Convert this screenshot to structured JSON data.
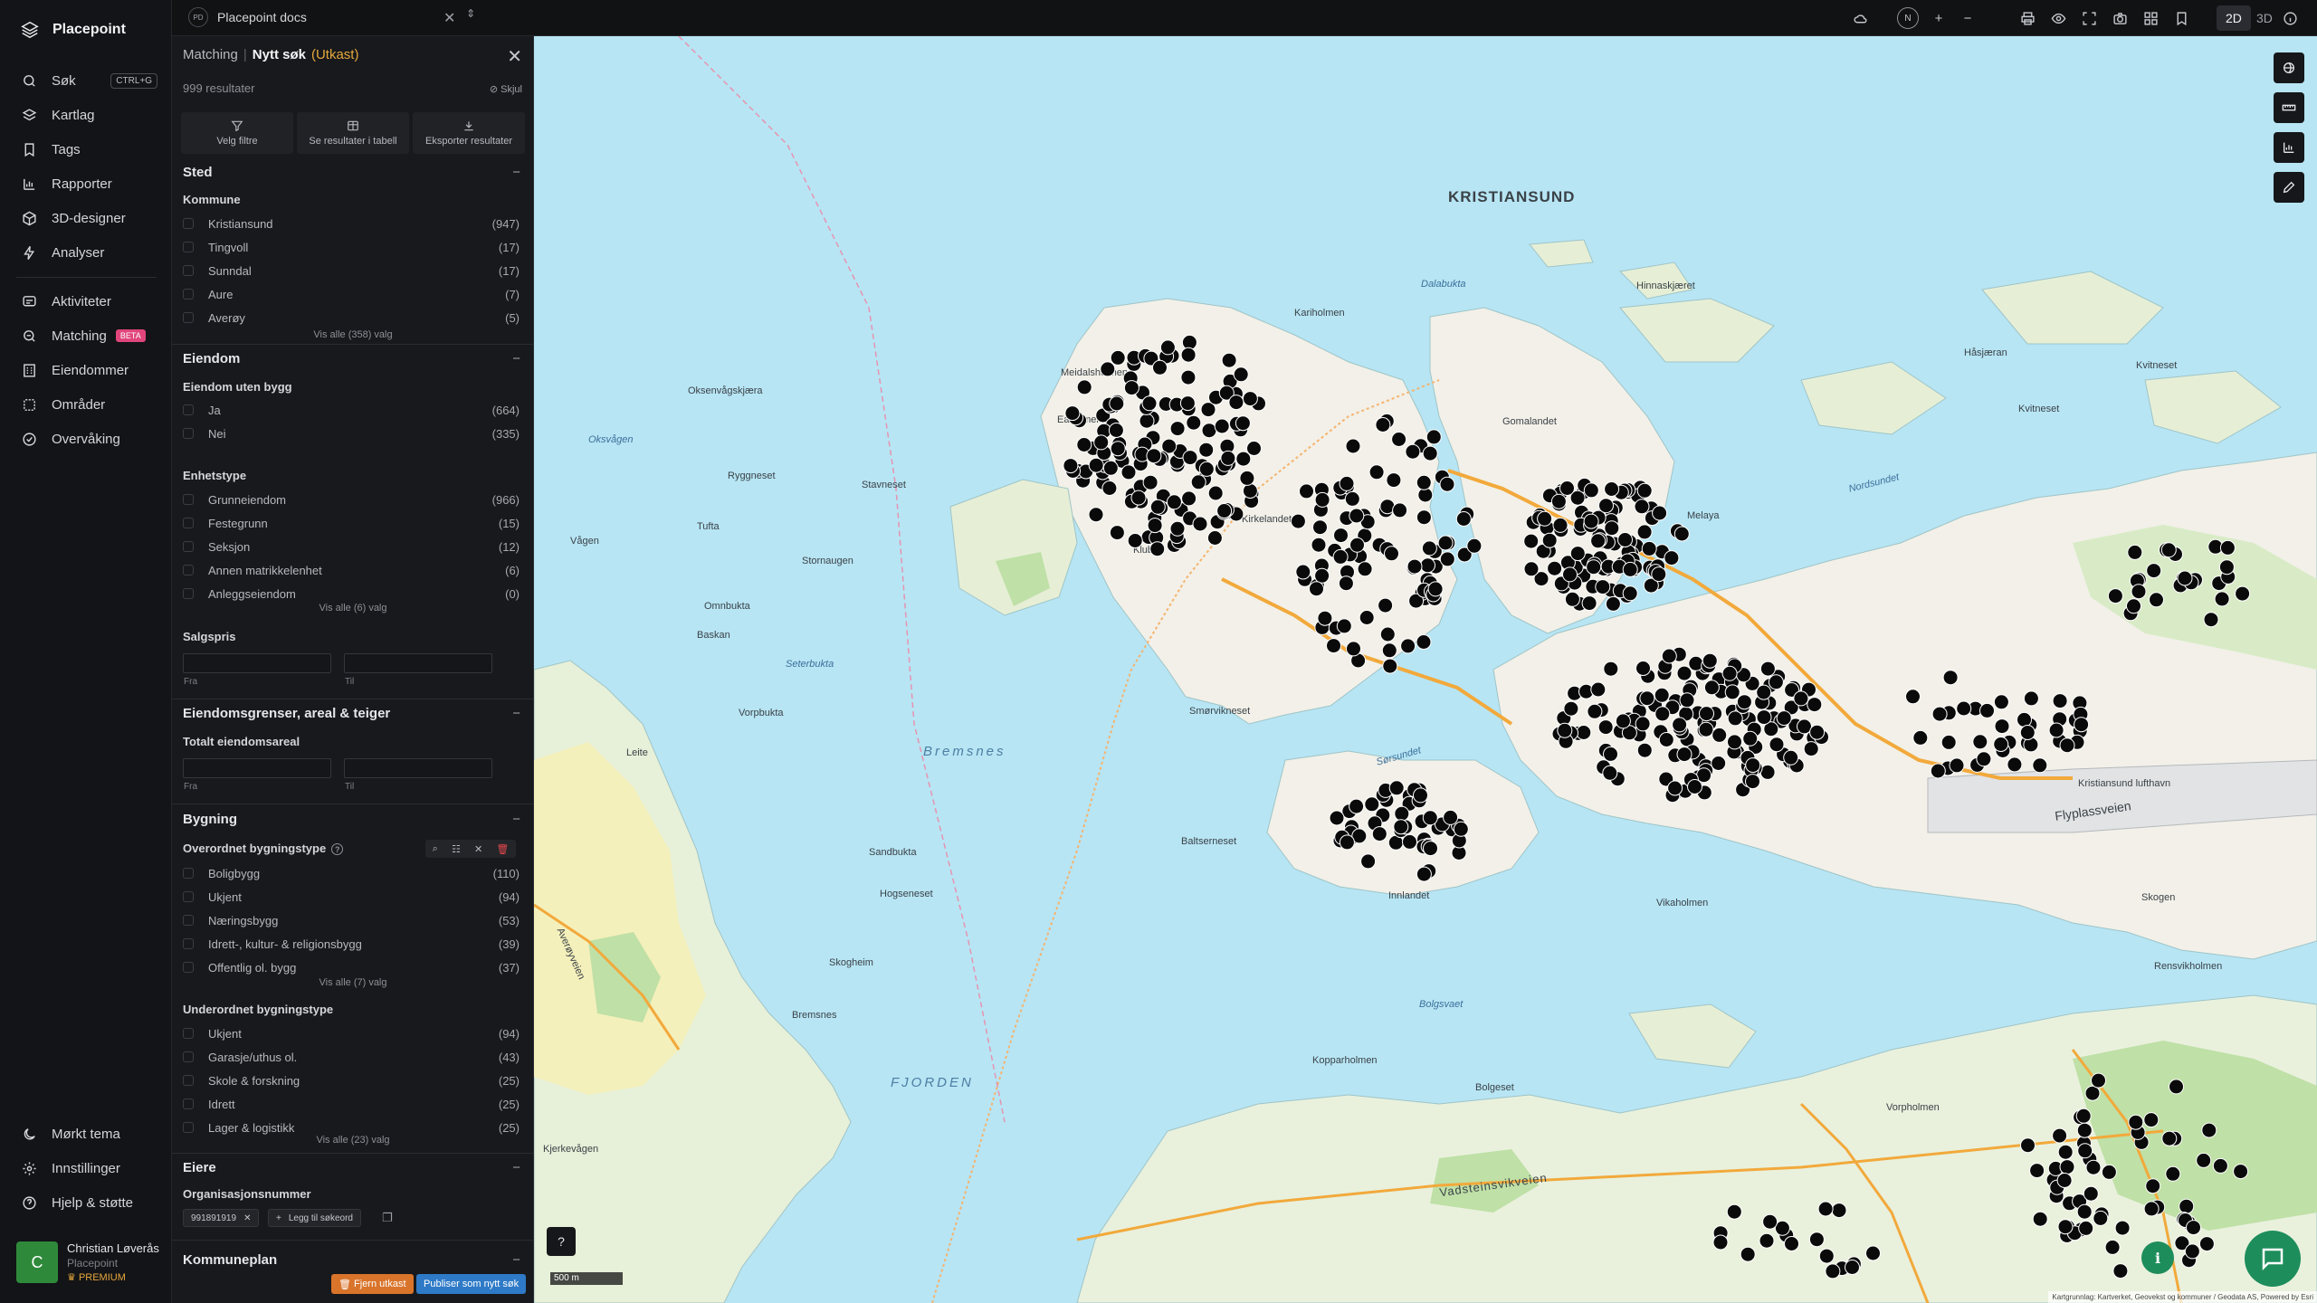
{
  "app": {
    "name": "Placepoint"
  },
  "nav": {
    "items": [
      {
        "label": "Søk",
        "shortcut": "CTRL+G"
      },
      {
        "label": "Kartlag"
      },
      {
        "label": "Tags"
      },
      {
        "label": "Rapporter"
      },
      {
        "label": "3D-designer"
      },
      {
        "label": "Analyser"
      },
      {
        "label": "Aktiviteter"
      },
      {
        "label": "Matching",
        "badge": "BETA"
      },
      {
        "label": "Eiendommer"
      },
      {
        "label": "Områder"
      },
      {
        "label": "Overvåking"
      }
    ],
    "bottom": [
      {
        "label": "Mørkt tema"
      },
      {
        "label": "Innstillinger"
      },
      {
        "label": "Hjelp & støtte"
      }
    ],
    "user": {
      "initial": "C",
      "name": "Christian Løverås",
      "org": "Placepoint",
      "plan": "PREMIUM"
    }
  },
  "topbar": {
    "doc_badge": "PD",
    "doc_name": "Placepoint docs",
    "compass": "N",
    "mode_2d": "2D",
    "mode_3d": "3D"
  },
  "panel": {
    "crumb": "Matching",
    "title": "Nytt søk",
    "status": "(Utkast)",
    "results": "999 resultater",
    "hide": "Skjul",
    "actions": [
      "Velg filtre",
      "Se resultater i tabell",
      "Eksporter resultater"
    ],
    "sted": {
      "title": "Sted",
      "kommune_label": "Kommune",
      "kommune": [
        {
          "name": "Kristiansund",
          "count": "(947)"
        },
        {
          "name": "Tingvoll",
          "count": "(17)"
        },
        {
          "name": "Sunndal",
          "count": "(17)"
        },
        {
          "name": "Aure",
          "count": "(7)"
        },
        {
          "name": "Averøy",
          "count": "(5)"
        }
      ],
      "more": "Vis alle (358) valg"
    },
    "eiendom": {
      "title": "Eiendom",
      "uten_bygg_label": "Eiendom uten bygg",
      "uten_bygg": [
        {
          "name": "Ja",
          "count": "(664)"
        },
        {
          "name": "Nei",
          "count": "(335)"
        }
      ],
      "enhetstype_label": "Enhetstype",
      "enhetstype": [
        {
          "name": "Grunneiendom",
          "count": "(966)"
        },
        {
          "name": "Festegrunn",
          "count": "(15)"
        },
        {
          "name": "Seksjon",
          "count": "(12)"
        },
        {
          "name": "Annen matrikkelenhet",
          "count": "(6)"
        },
        {
          "name": "Anleggseiendom",
          "count": "(0)"
        }
      ],
      "enhetstype_more": "Vis alle (6) valg",
      "salgspris_label": "Salgspris",
      "from": "Fra",
      "to": "Til"
    },
    "grenser": {
      "title": "Eiendomsgrenser, areal & teiger",
      "areal_label": "Totalt eiendomsareal",
      "from": "Fra",
      "to": "Til"
    },
    "bygning": {
      "title": "Bygning",
      "over_label": "Overordnet bygningstype",
      "over": [
        {
          "name": "Boligbygg",
          "count": "(110)"
        },
        {
          "name": "Ukjent",
          "count": "(94)"
        },
        {
          "name": "Næringsbygg",
          "count": "(53)"
        },
        {
          "name": "Idrett-, kultur- & religionsbygg",
          "count": "(39)"
        },
        {
          "name": "Offentlig ol. bygg",
          "count": "(37)"
        }
      ],
      "over_more": "Vis alle (7) valg",
      "under_label": "Underordnet bygningstype",
      "under": [
        {
          "name": "Ukjent",
          "count": "(94)"
        },
        {
          "name": "Garasje/uthus ol.",
          "count": "(43)"
        },
        {
          "name": "Skole & forskning",
          "count": "(25)"
        },
        {
          "name": "Idrett",
          "count": "(25)"
        },
        {
          "name": "Lager & logistikk",
          "count": "(25)"
        }
      ],
      "under_more": "Vis alle (23) valg"
    },
    "eiere": {
      "title": "Eiere",
      "org_label": "Organisasjonsnummer",
      "org_value": "991891919",
      "add_label": "Legg til søkeord"
    },
    "kommuneplan": {
      "title": "Kommuneplan"
    },
    "remove_draft": "Fjern utkast",
    "publish": "Publiser som nytt søk"
  },
  "map": {
    "labels": {
      "kristiansund": "KRISTIANSUND",
      "bremsnes": "Bremsnes",
      "fjorden": "FJORDEN",
      "dalabukta": "Dalabukta",
      "hinnaskjaeret": "Hinnaskjæret",
      "haasjaeran": "Håsjæran",
      "kvitneset": "Kvitneset",
      "meidalsholmen": "Meidalsholmen",
      "eaholmen": "Eaholmen",
      "oksenvagskjaera": "Oksenvågskjæra",
      "ryggneset": "Ryggneset",
      "stavneset": "Stavneset",
      "oksvagen": "Oksvågen",
      "tufta": "Tufta",
      "vaagen": "Vågen",
      "stornaugen": "Stornaugen",
      "omnbukta": "Omnbukta",
      "baskan": "Baskan",
      "seterbukta": "Seterbukta",
      "vorpbukta": "Vorpbukta",
      "leite": "Leite",
      "smorvikneset": "Smørvikneset",
      "baltsemeset": "Baltserneset",
      "innlandet": "Innlandet",
      "sandbukta": "Sandbukta",
      "hogseneset": "Hogseneset",
      "skogheim": "Skogheim",
      "bolgsvaet": "Bolgsvaet",
      "kopparholmen": "Kopparholmen",
      "bolgeset": "Bolgeset",
      "vadsteinsvikveien": "Vadsteinsvikveien",
      "vikaholmen": "Vikaholmen",
      "flyplassveien": "Flyplassveien",
      "kvitneset2": "Kvitneset",
      "nordsundet": "Nordsundet",
      "melaya": "Melaya",
      "gomalandet": "Gomalandet",
      "kirkelandet": "Kirkelandet",
      "klubba": "Klubba",
      "karihola": "Kariholmen",
      "sorsundet": "Sørsundet",
      "skogen": "Skogen",
      "rensvikholmen": "Rensvikholmen",
      "averoyveien": "Averøyveien",
      "kjerkevågen": "Kjerkevågen",
      "vorpholmen": "Vorpholmen",
      "kristiansundlufthavn": "Kristiansund lufthavn"
    },
    "scale": "500 m",
    "attribution": "Kartgrunnlag: Kartverket, Geovekst og kommuner / Geodata AS, Powered by Esri"
  }
}
